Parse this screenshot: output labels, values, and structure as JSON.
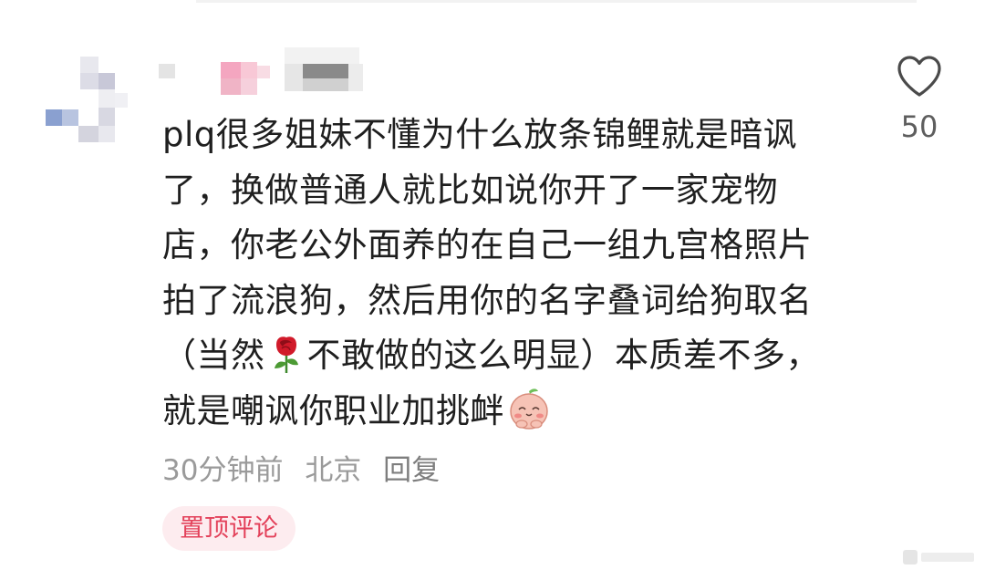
{
  "comment": {
    "text_lines": [
      "plq很多姐妹不懂为什么放条锦鲤就是暗讽",
      "了，换做普通人就比如说你开了一家宠物",
      "店，你老公外面养的在自己一组九宫格照片",
      "拍了流浪狗，然后用你的名字叠词给狗取名"
    ],
    "line5_before_emoji": "（当然",
    "line5_after_emoji": "不敢做的这么明显）本质差不多，",
    "line6": "就是嘲讽你职业加挑衅",
    "rose_emoji": "rose-emoji",
    "peach_emoji": "peach-face-emoji"
  },
  "meta": {
    "time": "30分钟前",
    "location": "北京",
    "reply": "回复"
  },
  "pin_badge": "置顶评论",
  "like": {
    "icon": "heart-outline-icon",
    "count": "50"
  },
  "colors": {
    "text": "#1f1f1f",
    "meta": "#9a9a9a",
    "badge_bg": "#fdecef",
    "badge_text": "#e3415a",
    "rose": "#d11a2a",
    "peach": "#f5b5a8"
  }
}
